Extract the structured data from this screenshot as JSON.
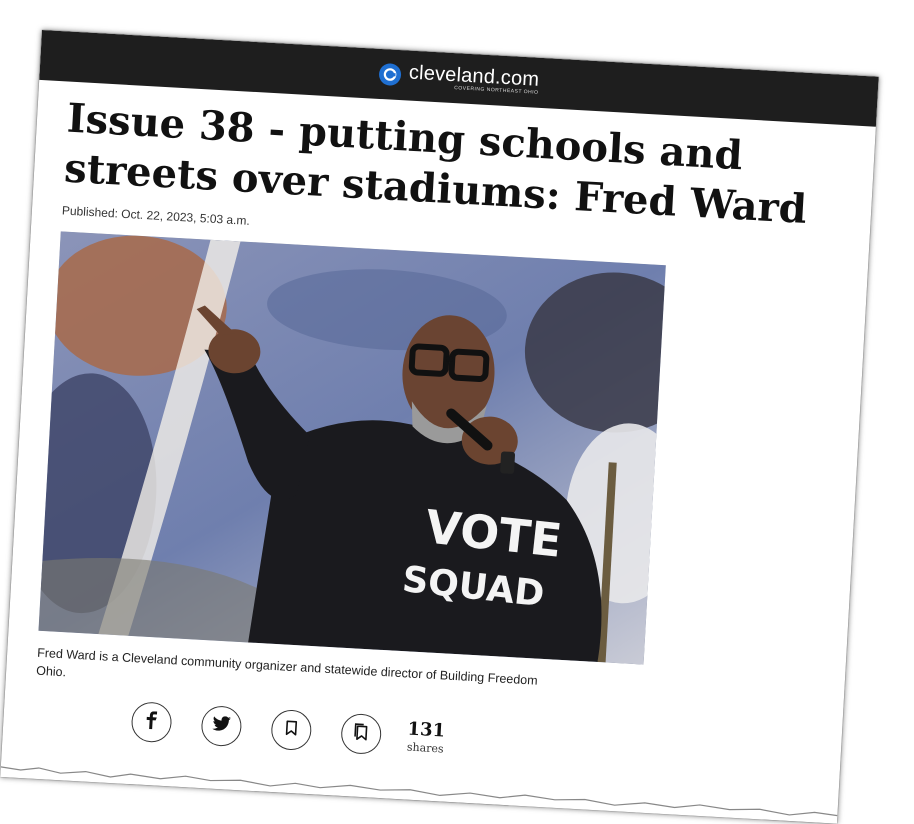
{
  "header": {
    "logo_text": "cleveland.com",
    "logo_tagline": "COVERING NORTHEAST OHIO"
  },
  "article": {
    "headline": "Issue 38 - putting schools and streets over stadiums: Fred Ward",
    "published": "Published: Oct. 22, 2023, 5:03 a.m.",
    "photo_shirt_line1": "VOTE",
    "photo_shirt_line2": "SQUAD",
    "caption": "Fred Ward is a Cleveland community organizer and statewide director of Building Freedom Ohio."
  },
  "social": {
    "buttons": [
      "facebook-icon",
      "twitter-icon",
      "bookmark-icon",
      "saved-list-icon"
    ],
    "share_count": "131",
    "share_label": "shares"
  },
  "colors": {
    "topbar": "#1e1e1e",
    "logo_accent": "#1f6fd1"
  }
}
